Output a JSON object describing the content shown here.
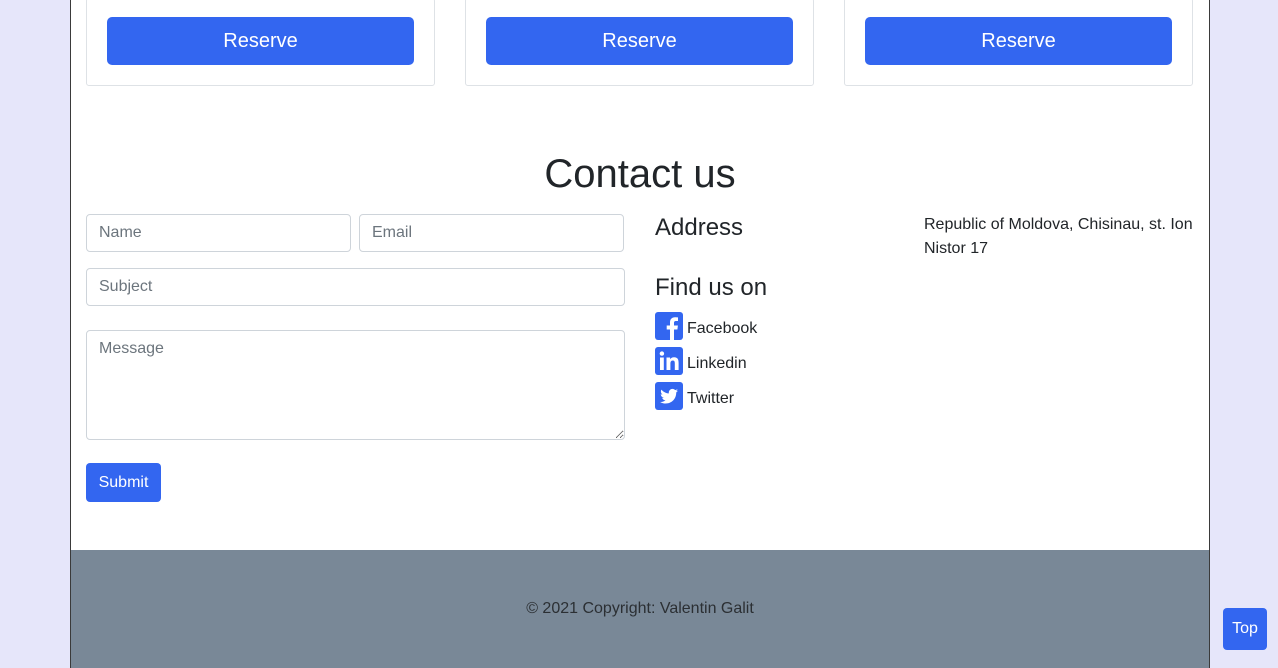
{
  "cards": [
    {
      "button_label": "Reserve"
    },
    {
      "button_label": "Reserve"
    },
    {
      "button_label": "Reserve"
    }
  ],
  "contact": {
    "title": "Contact us",
    "form": {
      "name_placeholder": "Name",
      "email_placeholder": "Email",
      "subject_placeholder": "Subject",
      "message_placeholder": "Message",
      "submit_label": "Submit"
    },
    "address_heading": "Address",
    "address_text": "Republic of Moldova, Chisinau, st. Ion Nistor 17",
    "find_us_heading": "Find us on",
    "social": [
      {
        "label": "Facebook",
        "icon": "facebook-icon"
      },
      {
        "label": "Linkedin",
        "icon": "linkedin-icon"
      },
      {
        "label": "Twitter",
        "icon": "twitter-icon"
      }
    ]
  },
  "footer": {
    "copyright": "© 2021 Copyright: Valentin Galit"
  },
  "top_button": {
    "label": "Top"
  },
  "colors": {
    "accent": "#3366f0",
    "background": "#e6e6fa",
    "footer_bg": "#798897"
  }
}
